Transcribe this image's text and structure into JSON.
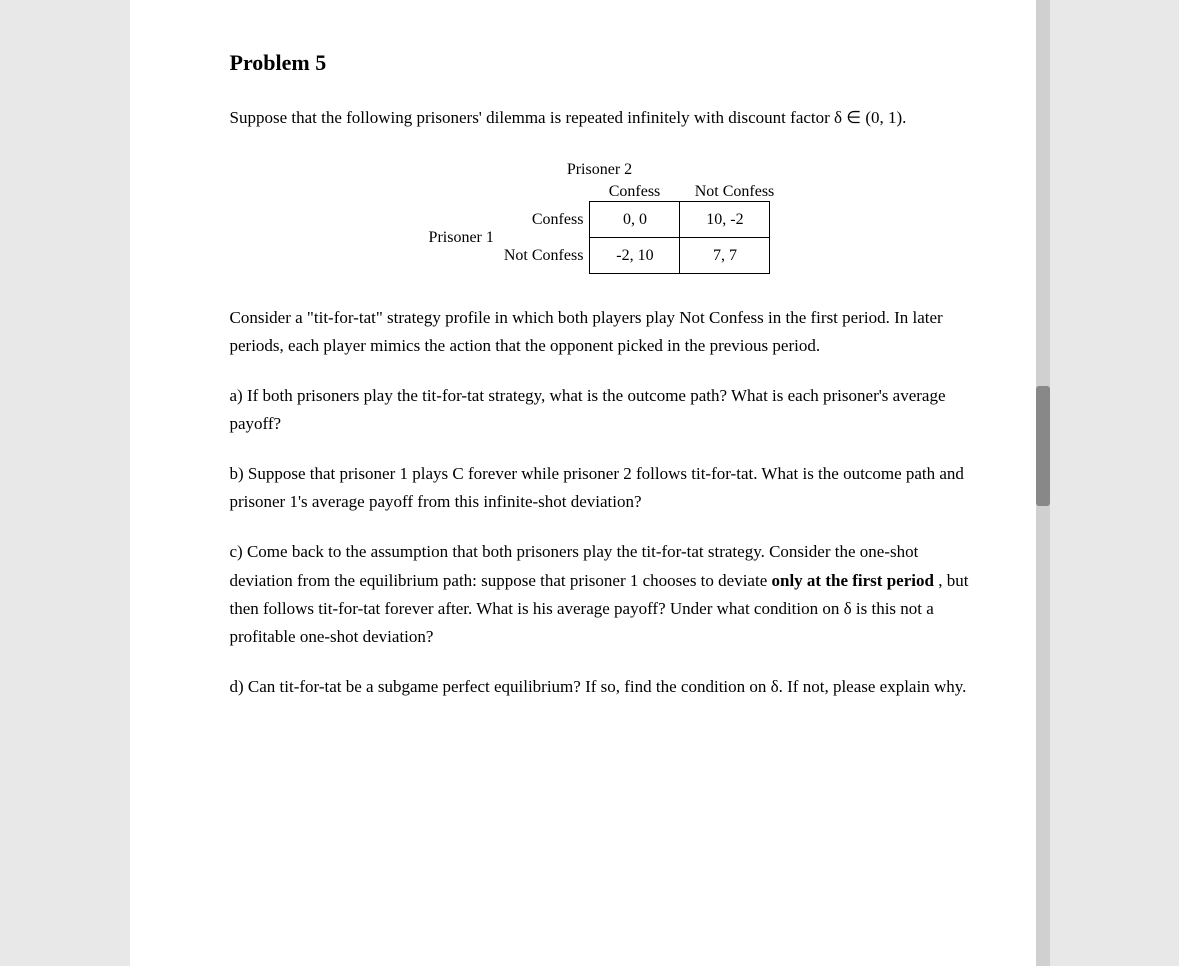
{
  "page": {
    "title": "Problem 5",
    "intro": "Suppose that the following prisoners' dilemma is repeated infinitely with discount factor δ ∈ (0, 1).",
    "matrix": {
      "prisoner2_label": "Prisoner 2",
      "prisoner1_label": "Prisoner 1",
      "col_headers": [
        "Confess",
        "Not Confess"
      ],
      "row_labels": [
        "Confess",
        "Not Confess"
      ],
      "cells": [
        [
          "0, 0",
          "10, -2"
        ],
        [
          "-2, 10",
          "7, 7"
        ]
      ]
    },
    "tit_for_tat_desc": "Consider a \"tit-for-tat\" strategy profile in which both players play Not Confess in the first period. In later periods, each player mimics the action that the opponent picked in the previous period.",
    "questions": {
      "a": "a) If both prisoners play the tit-for-tat strategy, what is the outcome path?  What is each prisoner's average payoff?",
      "b": "b) Suppose that prisoner 1 plays C forever while prisoner 2 follows tit-for-tat.  What is the outcome path and prisoner 1's average payoff from this infinite-shot deviation?",
      "c_part1": "c) Come back to the assumption that both prisoners play the tit-for-tat strategy.  Consider the one-shot deviation from the equilibrium path: suppose that prisoner 1 chooses to deviate",
      "c_bold": "only at the first period",
      "c_part2": ", but then follows tit-for-tat forever after.  What is his average payoff? Under what condition on δ is this not a profitable one-shot deviation?",
      "d": "d) Can tit-for-tat be a subgame perfect equilibrium?  If so, find the condition on δ.  If not, please explain why."
    }
  }
}
